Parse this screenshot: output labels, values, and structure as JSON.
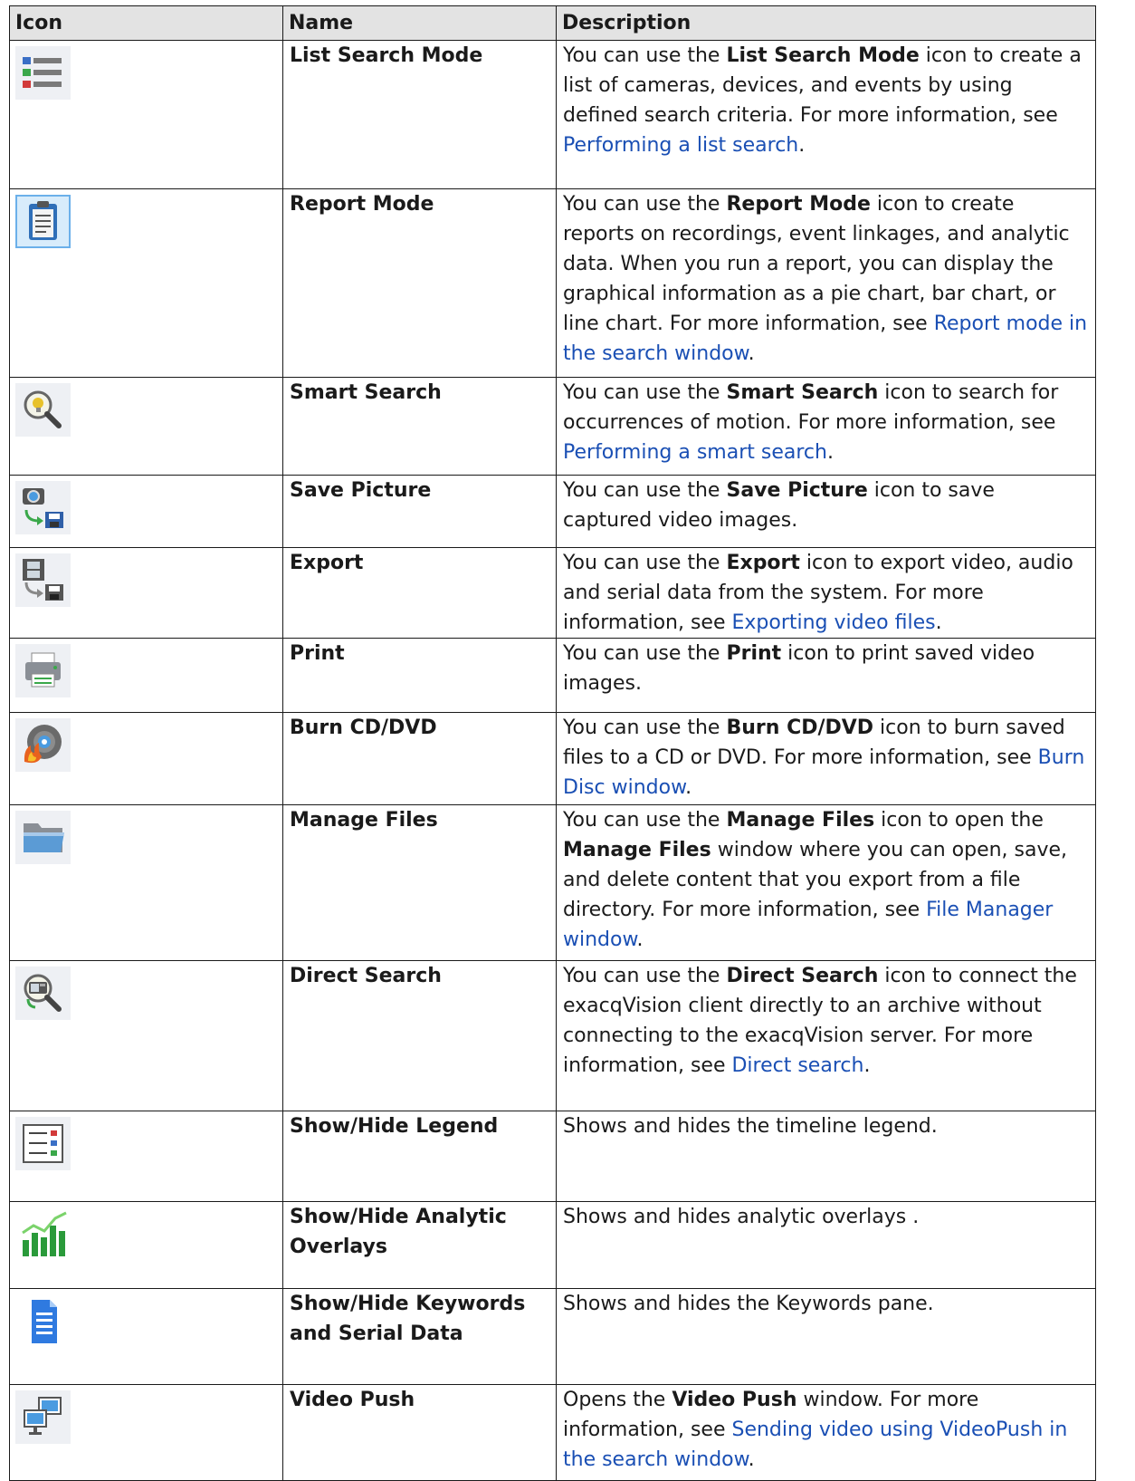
{
  "headers": {
    "icon": "Icon",
    "name": "Name",
    "description": "Description"
  },
  "rows": [
    {
      "icon": "list-search-mode-icon",
      "name": "List Search Mode",
      "desc": [
        [
          "You can use the ",
          "t"
        ],
        [
          "List Search Mode",
          "b"
        ],
        [
          " icon to create a list of cameras, devices, and events by using defined search criteria. For more information, see ",
          "t"
        ],
        [
          "Performing a list search",
          "l"
        ],
        [
          ".",
          "t"
        ]
      ]
    },
    {
      "icon": "report-mode-icon",
      "name": "Report Mode",
      "desc": [
        [
          "You can use the ",
          "t"
        ],
        [
          "Report Mode",
          "b"
        ],
        [
          " icon to create reports on recordings, event linkages, and analytic data. When you run a report, you can display the graphical information as a pie chart, bar chart, or line chart. For more information, see ",
          "t"
        ],
        [
          "Report mode in the search window",
          "l"
        ],
        [
          ".",
          "t"
        ]
      ]
    },
    {
      "icon": "smart-search-icon",
      "name": "Smart Search",
      "desc": [
        [
          "You can use the ",
          "t"
        ],
        [
          "Smart Search",
          "b"
        ],
        [
          " icon to search for occurrences of motion. For more information, see ",
          "t"
        ],
        [
          "Performing a smart search",
          "l"
        ],
        [
          ".",
          "t"
        ]
      ]
    },
    {
      "icon": "save-picture-icon",
      "name": "Save Picture",
      "desc": [
        [
          "You can use the ",
          "t"
        ],
        [
          "Save Picture",
          "b"
        ],
        [
          " icon to save captured video images.",
          "t"
        ]
      ]
    },
    {
      "icon": "export-icon",
      "name": "Export",
      "desc": [
        [
          "You can use the ",
          "t"
        ],
        [
          "Export",
          "b"
        ],
        [
          " icon to export video, audio and serial data from the system. For more information, see ",
          "t"
        ],
        [
          "Exporting video files",
          "l"
        ],
        [
          ".",
          "t"
        ]
      ]
    },
    {
      "icon": "print-icon",
      "name": "Print",
      "desc": [
        [
          "You can use the ",
          "t"
        ],
        [
          "Print",
          "b"
        ],
        [
          " icon to print saved video images.",
          "t"
        ]
      ]
    },
    {
      "icon": "burn-disc-icon",
      "name": "Burn CD/DVD",
      "desc": [
        [
          "You can use the ",
          "t"
        ],
        [
          "Burn CD/DVD",
          "b"
        ],
        [
          " icon to burn saved files to a CD or DVD. For more information, see ",
          "t"
        ],
        [
          "Burn Disc window",
          "l"
        ],
        [
          ".",
          "t"
        ]
      ]
    },
    {
      "icon": "folder-icon",
      "name": "Manage Files",
      "desc": [
        [
          "You can use the ",
          "t"
        ],
        [
          "Manage Files",
          "b"
        ],
        [
          " icon to open the ",
          "t"
        ],
        [
          "Manage Files",
          "b"
        ],
        [
          " window where you can open, save, and delete content that you export from a file directory. For more information, see ",
          "t"
        ],
        [
          "File Manager window",
          "l"
        ],
        [
          ".",
          "t"
        ]
      ]
    },
    {
      "icon": "direct-search-icon",
      "name": "Direct Search",
      "desc": [
        [
          "You can use the ",
          "t"
        ],
        [
          "Direct Search",
          "b"
        ],
        [
          " icon to connect the exacqVision client directly to an archive without connecting to the exacqVision server. For more information, see ",
          "t"
        ],
        [
          "Direct search",
          "l"
        ],
        [
          ".",
          "t"
        ]
      ]
    },
    {
      "icon": "legend-icon",
      "name": "Show/Hide Legend",
      "desc": [
        [
          "Shows and hides the timeline legend.",
          "t"
        ]
      ]
    },
    {
      "icon": "analytic-overlay-icon",
      "name": "Show/Hide Analytic Overlays",
      "desc": [
        [
          "Shows and hides analytic overlays .",
          "t"
        ]
      ]
    },
    {
      "icon": "document-icon",
      "name": "Show/Hide Keywords and Serial Data",
      "desc": [
        [
          "Shows and hides the Keywords pane.",
          "t"
        ]
      ]
    },
    {
      "icon": "video-push-icon",
      "name": "Video Push",
      "desc": [
        [
          "Opens the ",
          "t"
        ],
        [
          "Video Push",
          "b"
        ],
        [
          " window. For more information, see ",
          "t"
        ],
        [
          "Sending video using VideoPush in the search window",
          "l"
        ],
        [
          ".",
          "t"
        ]
      ]
    }
  ]
}
